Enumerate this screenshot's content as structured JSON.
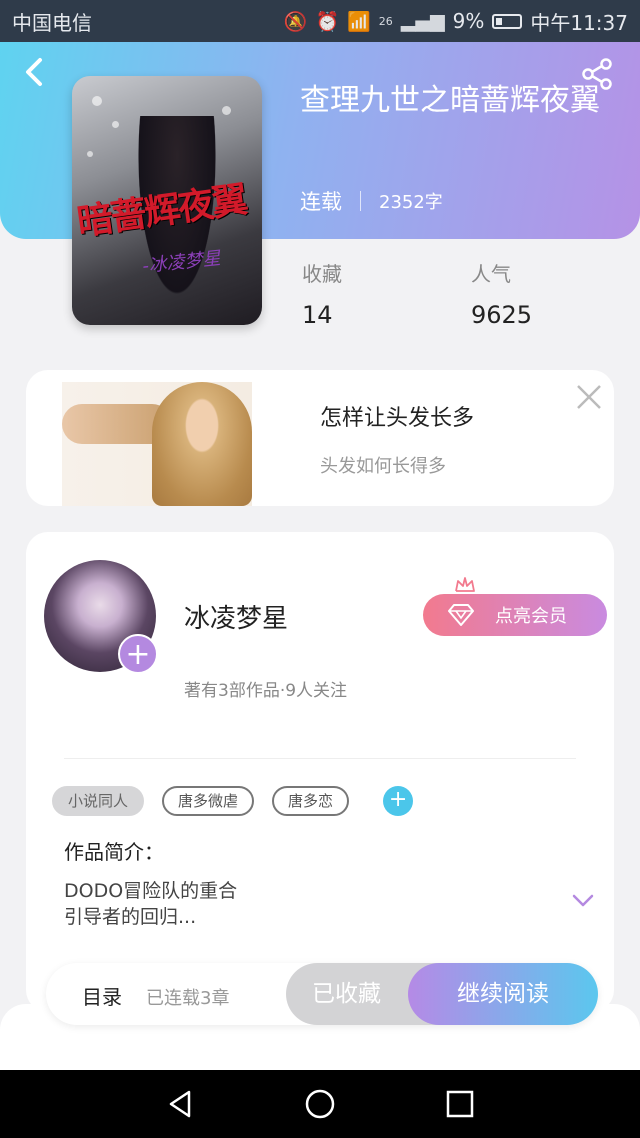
{
  "status_bar": {
    "carrier": "中国电信",
    "network": "26",
    "battery": "9%",
    "time": "中午11:37",
    "icons": [
      "mute-icon",
      "alarm-icon",
      "wifi-icon",
      "signal-icon",
      "battery-icon"
    ]
  },
  "header": {
    "back_icon": "back-arrow-icon",
    "share_icon": "share-icon",
    "gradient": [
      "#5fd3f0",
      "#b592e6"
    ]
  },
  "book": {
    "title": "查理九世之暗蔷辉夜翼",
    "cover_title": "暗蔷辉夜翼",
    "cover_author": "-冰凌梦星",
    "status": "连载",
    "word_count": "2352字",
    "stats": [
      {
        "label": "收藏",
        "value": "14"
      },
      {
        "label": "人气",
        "value": "9625"
      }
    ]
  },
  "ad": {
    "title": "怎样让头发长多",
    "subtitle": "头发如何长得多"
  },
  "author": {
    "name": "冰凌梦星",
    "stats": "著有3部作品·9人关注",
    "vip_button": "点亮会员",
    "vip_gradient": [
      "#f27a8e",
      "#c98be0"
    ]
  },
  "tags": [
    "小说同人",
    "唐多微虐",
    "唐多恋"
  ],
  "intro": {
    "label": "作品简介：",
    "text": "DODO冒险队的重合\n引导者的回归..."
  },
  "action_bar": {
    "toc_label": "目录",
    "progress": "已连载3章",
    "favorite_label": "已收藏",
    "read_label": "继续阅读"
  },
  "nav_bar": {
    "icons": [
      "nav-back-icon",
      "nav-home-icon",
      "nav-recents-icon"
    ]
  }
}
